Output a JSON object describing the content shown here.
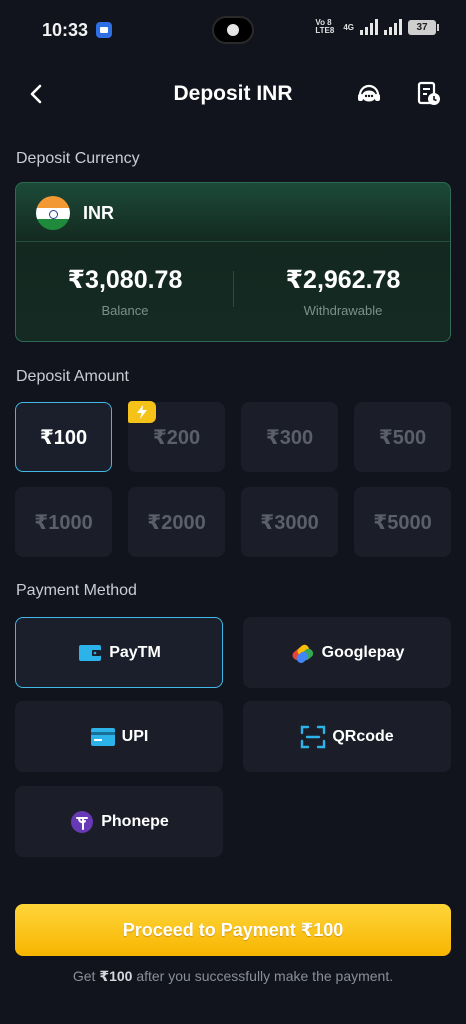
{
  "status_bar": {
    "time": "10:33",
    "network": "Vo 8 LTE8",
    "network_type": "4G",
    "battery": "37"
  },
  "header": {
    "title": "Deposit INR",
    "back_icon": "chevron-left-icon",
    "support_icon": "customer-support-icon",
    "history_icon": "deposit-history-icon"
  },
  "deposit_currency": {
    "section_label": "Deposit Currency",
    "currency_code": "INR",
    "flag": "india-flag-icon",
    "balance_value": "₹3,080.78",
    "balance_label": "Balance",
    "withdrawable_value": "₹2,962.78",
    "withdrawable_label": "Withdrawable"
  },
  "deposit_amount": {
    "section_label": "Deposit Amount",
    "options": [
      {
        "label": "₹100",
        "selected": true
      },
      {
        "label": "₹200",
        "selected": false,
        "badge": "lightning-icon"
      },
      {
        "label": "₹300",
        "selected": false
      },
      {
        "label": "₹500",
        "selected": false
      },
      {
        "label": "₹1000",
        "selected": false
      },
      {
        "label": "₹2000",
        "selected": false
      },
      {
        "label": "₹3000",
        "selected": false
      },
      {
        "label": "₹5000",
        "selected": false
      }
    ]
  },
  "payment_method": {
    "section_label": "Payment Method",
    "methods": [
      {
        "label": "PayTM",
        "icon": "wallet-icon",
        "selected": true
      },
      {
        "label": "Googlepay",
        "icon": "googlepay-icon",
        "selected": false
      },
      {
        "label": "UPI",
        "icon": "card-icon",
        "selected": false
      },
      {
        "label": "QRcode",
        "icon": "qr-scan-icon",
        "selected": false
      },
      {
        "label": "Phonepe",
        "icon": "phonepe-icon",
        "selected": false
      }
    ]
  },
  "proceed": {
    "label": "Proceed to Payment ₹100"
  },
  "footnote": {
    "prefix": "Get ",
    "amount": "₹100",
    "suffix": " after you successfully make the payment."
  },
  "colors": {
    "background": "#11141c",
    "accent_border": "#41b8e6",
    "proceed_button": "#f7b500",
    "currency_card": "#13281f"
  }
}
